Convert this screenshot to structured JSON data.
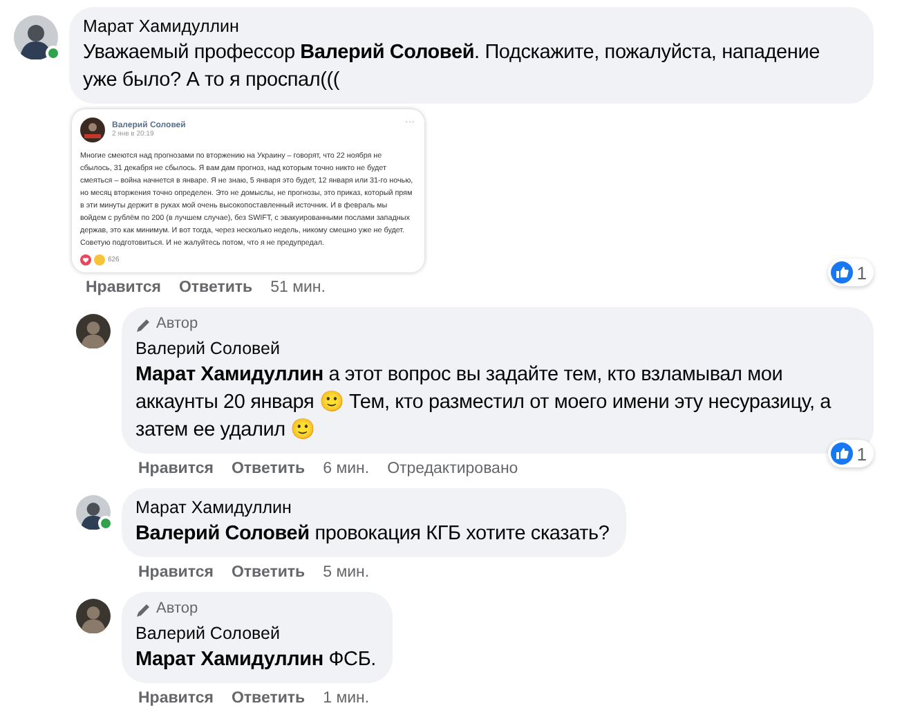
{
  "comments": [
    {
      "author": "Марат Хамидуллин",
      "online": true,
      "text": "Уважаемый профессор **Валерий Соловей**. Подскажите, пожалуйста, нападение уже было? А то я проспал(((",
      "attachment": {
        "kind": "post_screenshot",
        "author": "Валерий Соловей",
        "date": "2 янв в 20:19",
        "menu": "···",
        "text": "Многие смеются над прогнозами по вторжению на Украину – говорят, что 22 ноября не сбылось, 31 декабря не сбылось. Я вам дам прогноз, над которым точно никто не будет смеяться – война начнется в январе. Я не знаю, 5 января это будет, 12 января или 31-го ночью, но месяц вторжения точно определен. Это не домыслы, не прогнозы, это приказ, который прям в эти минуты держит в руках мой очень высокопоставленный источник. И в февраль мы войдем с рублём по 200 (в лучшем случае), без SWIFT, с эвакуированными послами западных держав, это как минимум. И вот тогда, через несколько недель, никому смешно уже не будет. Советую подготовиться. И не жалуйтесь потом, что я не предупредал.",
        "reactions": "626"
      },
      "actions": {
        "like": "Нравится",
        "reply": "Ответить",
        "time": "51 мин."
      },
      "likes": "1",
      "replies": [
        {
          "author": "Валерий Соловей",
          "online": false,
          "badge": "Автор",
          "text": "**Марат Хамидуллин** а этот вопрос вы задайте тем, кто взламывал мои аккаунты 20 января 🙂 Тем, кто разместил от моего имени эту несуразицу, а затем ее удалил 🙂",
          "actions": {
            "like": "Нравится",
            "reply": "Ответить",
            "time": "6 мин.",
            "edited": "Отредактировано"
          },
          "likes": "1"
        },
        {
          "author": "Марат Хамидуллин",
          "online": true,
          "text": "**Валерий Соловей** провокация КГБ хотите сказать?",
          "actions": {
            "like": "Нравится",
            "reply": "Ответить",
            "time": "5 мин."
          }
        },
        {
          "author": "Валерий Соловей",
          "online": false,
          "badge": "Автор",
          "text": "**Марат Хамидуллин** ФСБ.",
          "actions": {
            "like": "Нравится",
            "reply": "Ответить",
            "time": "1 мин."
          }
        }
      ]
    }
  ]
}
